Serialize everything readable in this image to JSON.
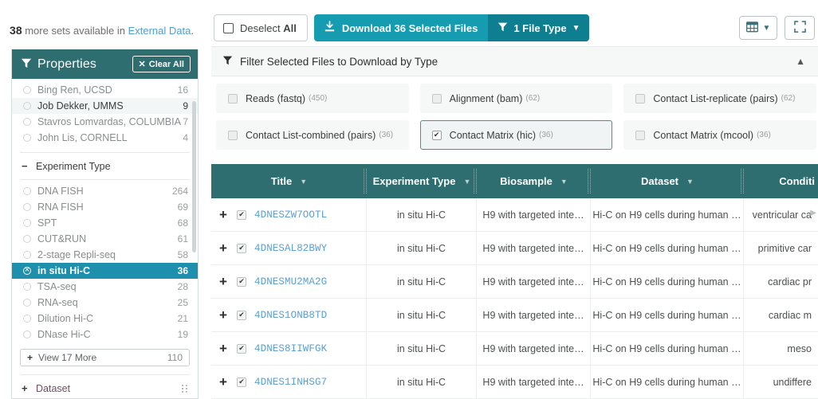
{
  "external_data": {
    "count": "38",
    "text_before": " more sets available in ",
    "link_label": "External Data",
    "text_after": "."
  },
  "facet_panel": {
    "title": "Properties",
    "funnel_icon": "funnel-icon",
    "clear_all_label": "Clear All",
    "clear_all_icon": "x-icon",
    "lab_items": [
      {
        "label": "Bing Ren, UCSD",
        "count": "16",
        "state": "normal"
      },
      {
        "label": "Job Dekker, UMMS",
        "count": "9",
        "state": "hover"
      },
      {
        "label": "Stavros Lomvardas, COLUMBIA",
        "count": "7",
        "state": "normal"
      },
      {
        "label": "John Lis, CORNELL",
        "count": "4",
        "state": "normal"
      }
    ],
    "experiment_type_group": {
      "label": "Experiment Type",
      "toggle": "−",
      "items": [
        {
          "label": "DNA FISH",
          "count": "264",
          "state": "normal"
        },
        {
          "label": "RNA FISH",
          "count": "69",
          "state": "normal"
        },
        {
          "label": "SPT",
          "count": "68",
          "state": "normal"
        },
        {
          "label": "CUT&RUN",
          "count": "61",
          "state": "normal"
        },
        {
          "label": "2-stage Repli-seq",
          "count": "58",
          "state": "normal"
        },
        {
          "label": "in situ Hi-C",
          "count": "36",
          "state": "selected"
        },
        {
          "label": "TSA-seq",
          "count": "28",
          "state": "normal"
        },
        {
          "label": "RNA-seq",
          "count": "25",
          "state": "normal"
        },
        {
          "label": "Dilution Hi-C",
          "count": "21",
          "state": "normal"
        },
        {
          "label": "DNase Hi-C",
          "count": "19",
          "state": "normal"
        }
      ],
      "view_more_label": "View 17 More",
      "view_more_count": "110",
      "view_more_icon": "plus-icon"
    },
    "dataset_group": {
      "label": "Dataset",
      "toggle": "+",
      "grip_icon": "drag-grip-icon"
    }
  },
  "toolbar": {
    "deselect_label_normal": "Deselect ",
    "deselect_label_bold": "All",
    "deselect_icon": "checkbox-empty-icon",
    "download_label": "Download 36 Selected Files",
    "download_icon": "download-icon",
    "filetype_label": "1 File Type",
    "filetype_icon": "funnel-icon",
    "filetype_caret": "chevron-down-icon",
    "columns_icon": "table-columns-icon",
    "columns_caret": "chevron-down-icon",
    "fullscreen_icon": "expand-icon",
    "colors": {
      "download_bg": "#169cb0",
      "filetype_bg": "#0e7f91",
      "header_teal": "#2e6d70",
      "selected_facet": "#1e8fad",
      "link_blue": "#5a9fd4"
    }
  },
  "filter_panel": {
    "title": "Filter Selected Files to Download by Type",
    "funnel_icon": "funnel-icon",
    "collapse_icon": "chevron-up-icon",
    "options": [
      {
        "label": "Reads (fastq)",
        "count": "(450)",
        "checked": false
      },
      {
        "label": "Alignment (bam)",
        "count": "(62)",
        "checked": false
      },
      {
        "label": "Contact List-replicate (pairs)",
        "count": "(62)",
        "checked": false
      },
      {
        "label": "Contact List-combined (pairs)",
        "count": "(36)",
        "checked": false
      },
      {
        "label": "Contact Matrix (hic)",
        "count": "(36)",
        "checked": true
      },
      {
        "label": "Contact Matrix (mcool)",
        "count": "(36)",
        "checked": false
      }
    ]
  },
  "table": {
    "columns": [
      {
        "label": "Title",
        "sort_icon": "sort-caret-icon"
      },
      {
        "label": "Experiment Type",
        "sort_icon": "sort-caret-icon"
      },
      {
        "label": "Biosample",
        "sort_icon": "sort-caret-icon"
      },
      {
        "label": "Dataset",
        "sort_icon": "sort-caret-icon"
      },
      {
        "label": "Conditi",
        "sort_icon": "sort-caret-icon"
      }
    ],
    "scroll_right_icon": "chevron-right-icon",
    "rows": [
      {
        "expand_icon": "plus-icon",
        "checked": true,
        "title": "4DNESZW7OOTL",
        "experiment_type": "in situ Hi-C",
        "biosample": "H9 with targeted inte…",
        "dataset": "Hi-C on H9 cells during human …",
        "condition": "ventricular ca"
      },
      {
        "expand_icon": "plus-icon",
        "checked": true,
        "title": "4DNESAL82BWY",
        "experiment_type": "in situ Hi-C",
        "biosample": "H9 with targeted inte…",
        "dataset": "Hi-C on H9 cells during human …",
        "condition": "primitive car"
      },
      {
        "expand_icon": "plus-icon",
        "checked": true,
        "title": "4DNESMU2MA2G",
        "experiment_type": "in situ Hi-C",
        "biosample": "H9 with targeted inte…",
        "dataset": "Hi-C on H9 cells during human …",
        "condition": "cardiac pr"
      },
      {
        "expand_icon": "plus-icon",
        "checked": true,
        "title": "4DNES1ONB8TD",
        "experiment_type": "in situ Hi-C",
        "biosample": "H9 with targeted inte…",
        "dataset": "Hi-C on H9 cells during human …",
        "condition": "cardiac m"
      },
      {
        "expand_icon": "plus-icon",
        "checked": true,
        "title": "4DNES8IIWFGK",
        "experiment_type": "in situ Hi-C",
        "biosample": "H9 with targeted inte…",
        "dataset": "Hi-C on H9 cells during human …",
        "condition": "meso"
      },
      {
        "expand_icon": "plus-icon",
        "checked": true,
        "title": "4DNES1INHSG7",
        "experiment_type": "in situ Hi-C",
        "biosample": "H9 with targeted inte…",
        "dataset": "Hi-C on H9 cells during human …",
        "condition": "undiffere"
      }
    ]
  }
}
